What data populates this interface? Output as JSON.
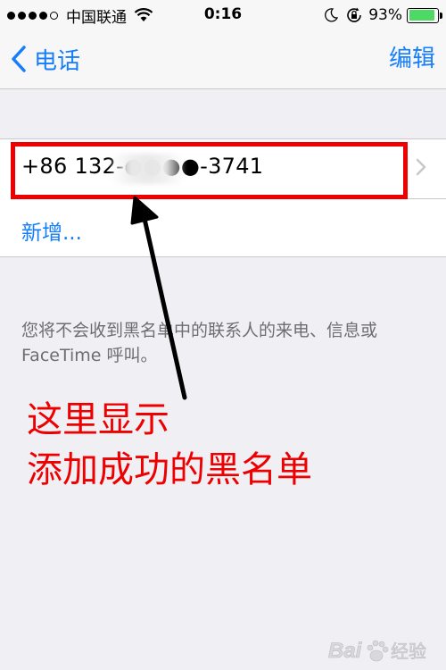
{
  "status_bar": {
    "signal_icon": "signal-dots-icon",
    "carrier": "中国联通",
    "wifi_icon": "wifi-icon",
    "time": "0:16",
    "moon_icon": "moon-icon",
    "rotation_lock_icon": "rotation-lock-icon",
    "battery_percent": "93%",
    "battery_level": 0.93,
    "battery_color": "#4cd964"
  },
  "nav": {
    "back_label": "电话",
    "edit_label": "编辑",
    "accent_color": "#157efb"
  },
  "blocked_list": {
    "entries": [
      {
        "phone": "+86 132-●●●●-3741"
      }
    ],
    "add_label": "新增..."
  },
  "footer_note": "您将不会收到黑名单中的联系人的来电、信息或 FaceTime 呼叫。",
  "annotation": {
    "caption_line1": "这里显示",
    "caption_line2": "添加成功的黑名单",
    "color": "#ee0000"
  },
  "watermark": {
    "text": "Bai 经验",
    "icon": "baidu-paw-icon"
  }
}
